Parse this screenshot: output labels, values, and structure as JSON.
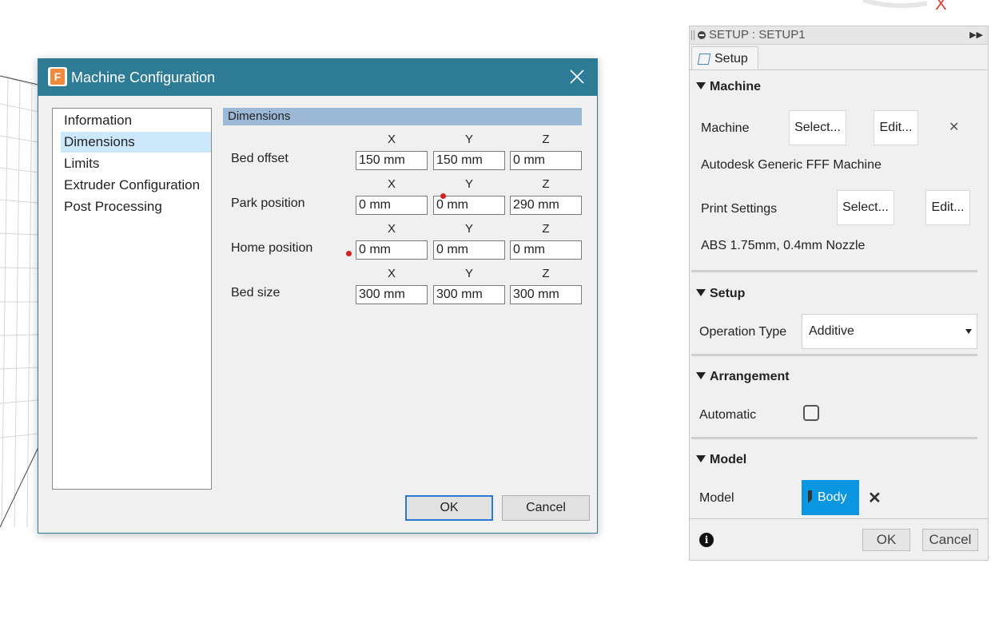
{
  "dialog": {
    "title": "Machine Configuration",
    "app_icon_letter": "F",
    "nav_items": [
      "Information",
      "Dimensions",
      "Limits",
      "Extruder Configuration",
      "Post Processing"
    ],
    "selected_nav": "Dimensions",
    "section_title": "Dimensions",
    "axis_labels": [
      "X",
      "Y",
      "Z"
    ],
    "rows": [
      {
        "label": "Bed offset",
        "values": [
          "150 mm",
          "150 mm",
          "0 mm"
        ]
      },
      {
        "label": "Park position",
        "values": [
          "0 mm",
          "0 mm",
          "290 mm"
        ]
      },
      {
        "label": "Home position",
        "values": [
          "0 mm",
          "0 mm",
          "0 mm"
        ]
      },
      {
        "label": "Bed size",
        "values": [
          "300 mm",
          "300 mm",
          "300 mm"
        ]
      }
    ],
    "ok_label": "OK",
    "cancel_label": "Cancel",
    "title_bar_color": "#2e7b96"
  },
  "panel": {
    "header_title": "SETUP : SETUP1",
    "tab_label": "Setup",
    "machine_section": "Machine",
    "machine_label": "Machine",
    "select_label": "Select...",
    "edit_label": "Edit...",
    "machine_name": "Autodesk Generic FFF Machine",
    "print_settings_label": "Print Settings",
    "print_settings_name": "ABS 1.75mm, 0.4mm Nozzle",
    "setup_section": "Setup",
    "operation_type_label": "Operation Type",
    "operation_type_value": "Additive",
    "arrangement_section": "Arrangement",
    "automatic_label": "Automatic",
    "automatic_checked": false,
    "model_section": "Model",
    "model_label": "Model",
    "model_value": "Body",
    "ok_label": "OK",
    "cancel_label": "Cancel",
    "accent_color": "#0a96e0"
  }
}
